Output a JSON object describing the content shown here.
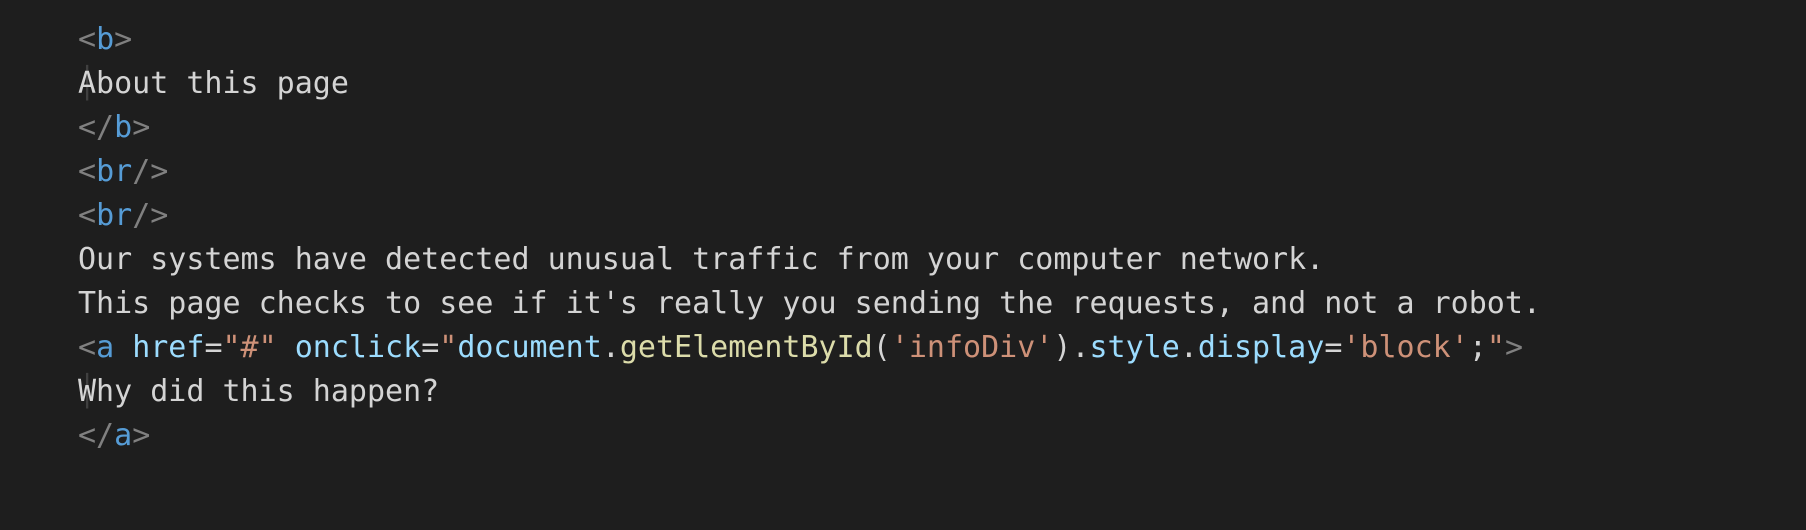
{
  "code": {
    "b_open_brk1": "<",
    "b_tag": "b",
    "b_open_brk2": ">",
    "b_text": "About this page",
    "b_close_brk1": "</",
    "b_close_brk2": ">",
    "br1_brk1": "<",
    "br_tag": "br",
    "br1_brk2": "/>",
    "br2_brk1": "<",
    "br2_brk2": "/>",
    "body_line1": "Our systems have detected unusual traffic from your computer network.",
    "body_line2": "This page checks to see if it's really you sending the requests, and not a robot.",
    "a_open_brk1": "<",
    "a_tag": "a",
    "a_space1": " ",
    "a_href_name": "href",
    "a_eq": "=",
    "a_href_val": "\"#\"",
    "a_space2": " ",
    "a_onclick_name": "onclick",
    "a_onclick_q1": "\"",
    "a_onclick_doc": "document",
    "a_onclick_dot1": ".",
    "a_onclick_fn": "getElementById",
    "a_onclick_p1": "(",
    "a_onclick_arg": "'infoDiv'",
    "a_onclick_p2": ")",
    "a_onclick_dot2": ".",
    "a_onclick_style": "style",
    "a_onclick_dot3": ".",
    "a_onclick_disp": "display",
    "a_onclick_assign": "=",
    "a_onclick_block": "'block'",
    "a_onclick_semi": ";",
    "a_onclick_q2": "\"",
    "a_open_brk2": ">",
    "a_text": "Why did this happen?",
    "a_close_brk1": "</",
    "a_close_brk2": ">",
    "guide": "│ "
  }
}
